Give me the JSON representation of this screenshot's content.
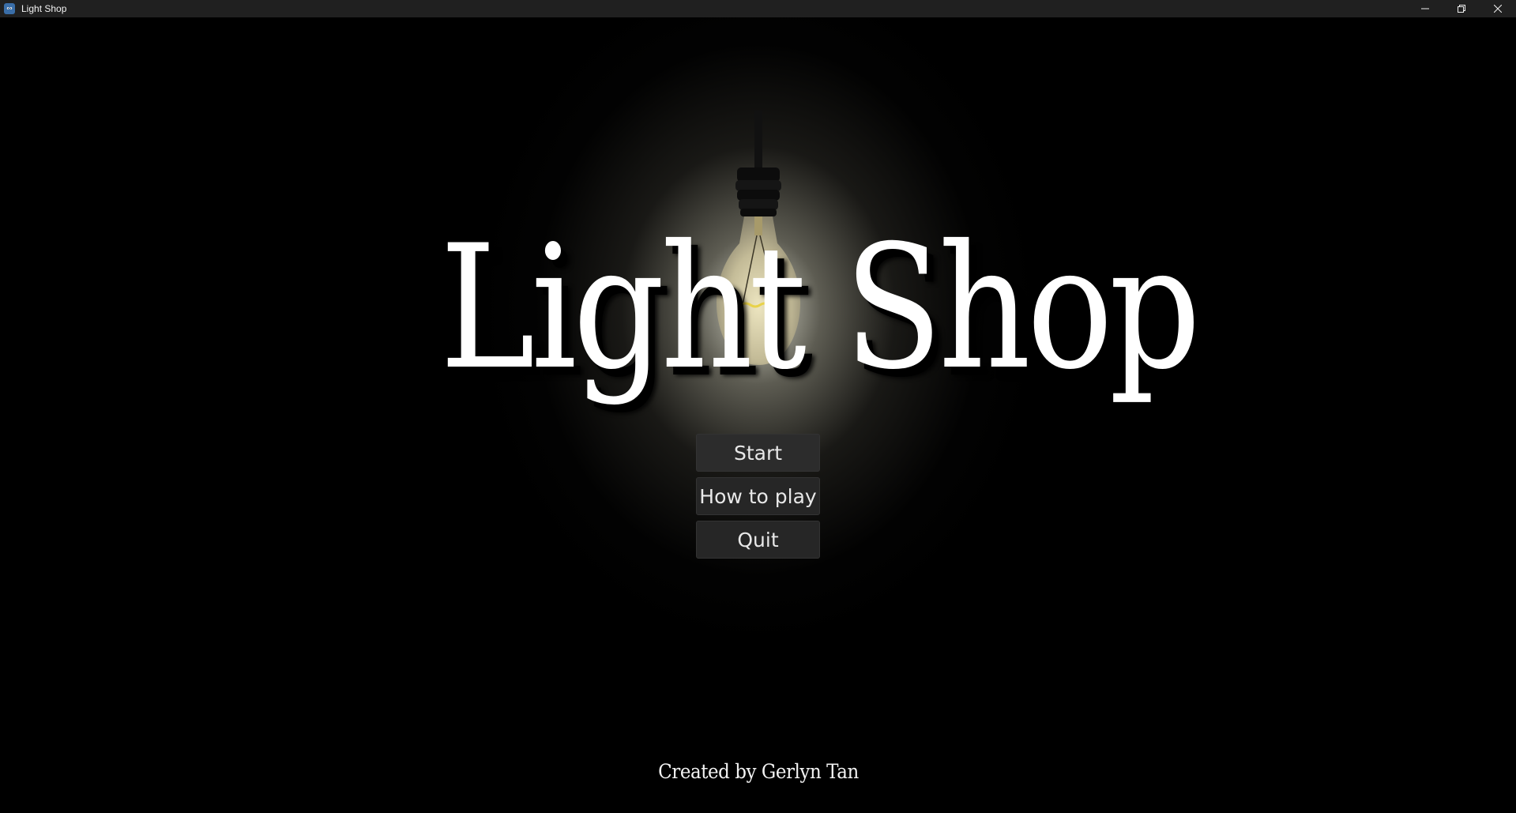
{
  "window": {
    "title": "Light Shop",
    "app_icon": "godot-engine-icon",
    "controls": [
      "minimize-icon",
      "restore-icon",
      "close-icon"
    ]
  },
  "game": {
    "title": "Light Shop",
    "menu": [
      {
        "label": "Start"
      },
      {
        "label": "How to play"
      },
      {
        "label": "Quit"
      }
    ],
    "credit": "Created by Gerlyn Tan"
  },
  "colors": {
    "background": "#000000",
    "titlebar": "#202020",
    "button_bg": "#262626",
    "text": "#ffffff",
    "bulb_filament": "#e8d24a"
  }
}
